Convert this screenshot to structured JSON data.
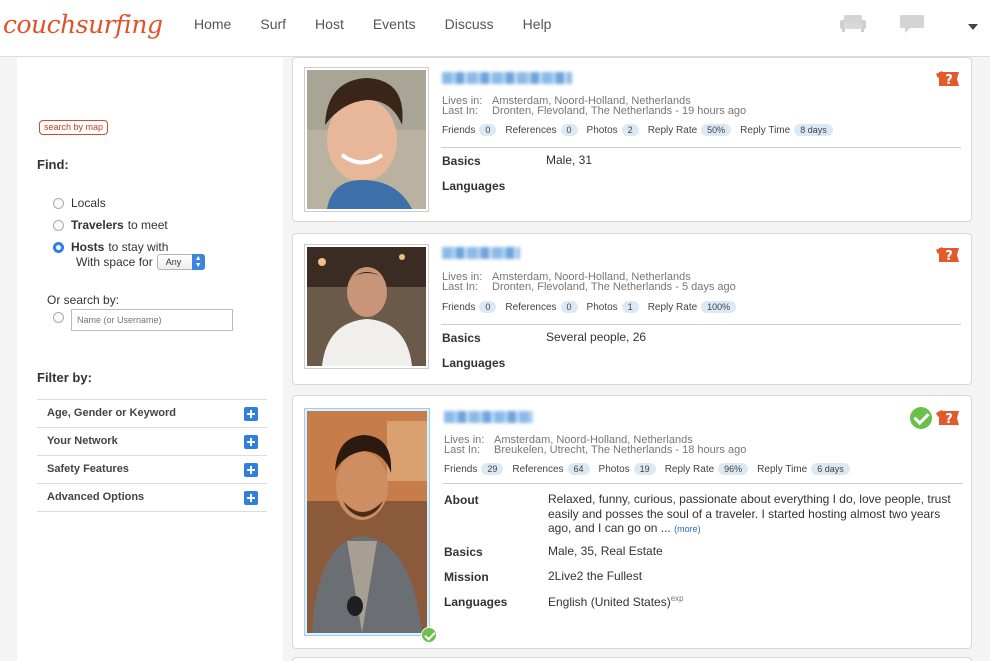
{
  "header": {
    "logo": "couchsurfing",
    "nav": [
      "Home",
      "Surf",
      "Host",
      "Events",
      "Discuss",
      "Help"
    ],
    "icons": [
      "couch-icon",
      "chat-icon",
      "chevron-down-icon"
    ]
  },
  "sidebar": {
    "search_by_map": "search by map",
    "find_label": "Find:",
    "options": {
      "locals": "Locals",
      "travelers_bold": "Travelers",
      "travelers_rest": "to meet",
      "hosts_bold": "Hosts",
      "hosts_rest": "to stay with"
    },
    "space_label": "With space for",
    "space_value": "Any",
    "or_search_label": "Or search by:",
    "name_placeholder": "Name (or Username)",
    "filter_label": "Filter by:",
    "filters": [
      "Age, Gender or Keyword",
      "Your Network",
      "Safety Features",
      "Advanced Options"
    ]
  },
  "profiles": [
    {
      "lives_in_label": "Lives in:",
      "lives_in": "Amsterdam, Noord-Holland, Netherlands",
      "last_in_label": "Last In:",
      "last_in": "Dronten, Flevoland, The Netherlands - 19 hours ago",
      "stats": [
        {
          "label": "Friends",
          "value": "0"
        },
        {
          "label": "References",
          "value": "0"
        },
        {
          "label": "Photos",
          "value": "2"
        },
        {
          "label": "Reply Rate",
          "value": "50%"
        },
        {
          "label": "Reply Time",
          "value": "8 days"
        }
      ],
      "basics_label": "Basics",
      "basics": "Male, 31",
      "languages_label": "Languages"
    },
    {
      "lives_in_label": "Lives in:",
      "lives_in": "Amsterdam, Noord-Holland, Netherlands",
      "last_in_label": "Last In:",
      "last_in": "Dronten, Flevoland, The Netherlands - 5 days ago",
      "stats": [
        {
          "label": "Friends",
          "value": "0"
        },
        {
          "label": "References",
          "value": "0"
        },
        {
          "label": "Photos",
          "value": "1"
        },
        {
          "label": "Reply Rate",
          "value": "100%"
        }
      ],
      "basics_label": "Basics",
      "basics": "Several people, 26",
      "languages_label": "Languages"
    },
    {
      "lives_in_label": "Lives in:",
      "lives_in": "Amsterdam, Noord-Holland, Netherlands",
      "last_in_label": "Last In:",
      "last_in": "Breukelen, Utrecht, The Netherlands - 18 hours ago",
      "stats": [
        {
          "label": "Friends",
          "value": "29"
        },
        {
          "label": "References",
          "value": "64"
        },
        {
          "label": "Photos",
          "value": "19"
        },
        {
          "label": "Reply Rate",
          "value": "96%"
        },
        {
          "label": "Reply Time",
          "value": "6 days"
        }
      ],
      "about_label": "About",
      "about": "Relaxed, funny, curious, passionate about everything I do, love people, trust easily and posses the soul of a traveler. I started hosting almost two years ago, and I can go on ...",
      "more_link": "(more)",
      "basics_label": "Basics",
      "basics": "Male, 35, Real Estate",
      "mission_label": "Mission",
      "mission": "2Live2 the Fullest",
      "languages_label": "Languages",
      "languages": "English (United States)",
      "languages_sup": "exp"
    }
  ],
  "colors": {
    "brand": "#e0522a",
    "accent_blue": "#2f7fe0",
    "verified_green": "#6cc04a",
    "badge_bg": "#dbe9f4"
  }
}
